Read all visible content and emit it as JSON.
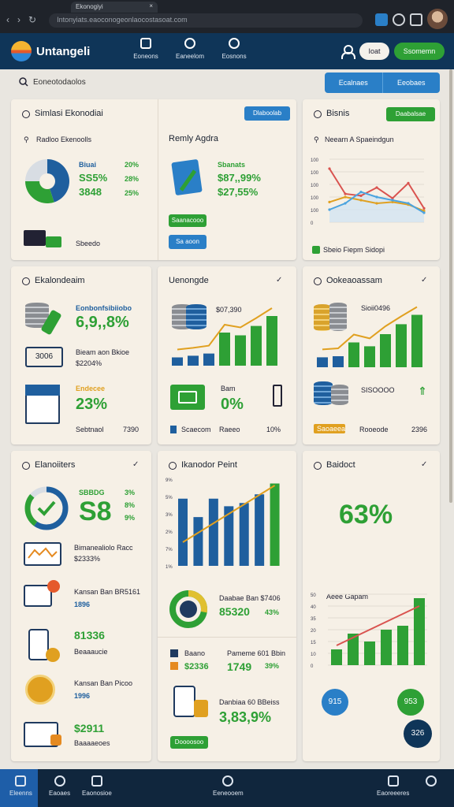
{
  "browser": {
    "tab_title": "Ekonogiyi",
    "tab_close": "×",
    "url": "Intonyiats.eaoconogeonlaocostasoat.com"
  },
  "app": {
    "brand": "Untangeli",
    "nav": [
      "Eoneons",
      "Eaneelom",
      "Eosnons"
    ],
    "btn_light": "Ioat",
    "btn_green": "Ssomemn"
  },
  "search": {
    "text": "Eoneotodaolos"
  },
  "top_pills": [
    "Ecalnaes",
    "Eeobaes"
  ],
  "cards": {
    "c1": {
      "title": "Simlasi Ekonodiai",
      "chip": "Dlaboolab",
      "sub": "Radloo Ekenoolls",
      "legend": [
        "Biuai",
        "SS5%",
        "3848"
      ],
      "legend_r": [
        "20%",
        "28%",
        "25%"
      ],
      "foot": "Sbeedo",
      "pie_values": [
        45,
        30,
        25
      ]
    },
    "c2": {
      "title": "Remly Agdra",
      "lines": [
        "Sbanats",
        "$87,,99%",
        "$27,55%"
      ],
      "chip_green": "Saanacooo",
      "chip_blue": "Sa aoon"
    },
    "c3": {
      "title": "Bisnis",
      "chip": "Daabalsae",
      "sub": "Neearn A Spaeindgun",
      "foot": "Sbeio  Fiepm  Sidopi"
    },
    "c4": {
      "title": "Ekalondeaim",
      "label": "Eonbonfsibiiobo",
      "value": "6,9,,8%",
      "box": "3006",
      "line1": "Bieam aon Bkioe",
      "line2": "$2204%",
      "small": "Endecee",
      "value2": "23%",
      "foot_l": "Sebtnaol",
      "foot_r": "7390"
    },
    "c5": {
      "title": "Uenongde",
      "check": "✓",
      "label": "$07,390",
      "small": "Bam",
      "value": "0%",
      "foot_l": "Scaecom",
      "foot_m": "Raeeo",
      "foot_r": "10%"
    },
    "c6": {
      "title": "Ookeaoassam",
      "check": "✓",
      "label": "Sioii0496",
      "label2": "SISOOOO",
      "foot_l": "Saoaeea",
      "foot_m": "Rooeode",
      "foot_r": "2396"
    },
    "c7": {
      "title": "Elanoiiters",
      "check": "✓",
      "l1": "SBBDG",
      "v1": "S8",
      "r": [
        "3%",
        "8%",
        "9%"
      ],
      "t2a": "Bimanealiolo Racc",
      "t2b": "$2333%",
      "t3a": "Kansan Ban BR5161",
      "t3b": "1896",
      "t4a": "81336",
      "t4b": "Beaaaucie",
      "t5a": "Kansan Ban Picoo",
      "t5b": "1996",
      "t6a": "$2911",
      "t6b": "Baaaaeoes"
    },
    "c8": {
      "title": "Ikanodor Peint",
      "yticks": [
        "9%",
        "5%",
        "3%",
        "2%",
        "7%",
        "1%"
      ],
      "bar_values": [
        62,
        45,
        62,
        55,
        58,
        66,
        76
      ],
      "t1a": "Daabae Ban $7406",
      "t1b": "85320",
      "t1c": "43%",
      "t2a": "Baano",
      "t2b": "$2336",
      "t2c": "Pameme 601 Bbin",
      "t2d": "1749",
      "t2e": "39%",
      "t3a": "Danbiaa 60 BBeiss",
      "t3b": "3,83,9%",
      "chip": "Doooosoo"
    },
    "c9": {
      "title": "Baidoct",
      "check": "✓",
      "value": "63%",
      "chart_label": "Aeee Gapam",
      "yticks": [
        "50",
        "40",
        "35",
        "20",
        "15",
        "10",
        "0"
      ],
      "badge_l": "915",
      "badge_r": "953",
      "fab": "326"
    }
  },
  "bottom_nav": [
    "Eleenns",
    "Eaoaes",
    "Eaonosioe",
    "Eeneooem",
    "Eaoreeeres"
  ],
  "chart_data": [
    {
      "type": "line",
      "series": [
        {
          "values": [
            85,
            45,
            42,
            55,
            38,
            62,
            22
          ]
        },
        {
          "values": [
            32,
            40,
            35,
            30,
            32,
            28,
            18
          ]
        },
        {
          "values": [
            20,
            30,
            48,
            40,
            35,
            30,
            15
          ]
        }
      ],
      "yticks": [
        "100",
        "100",
        "100",
        "100",
        "100",
        "0"
      ]
    },
    {
      "type": "bar",
      "values": [
        62,
        45,
        62,
        55,
        58,
        66,
        76
      ]
    }
  ]
}
